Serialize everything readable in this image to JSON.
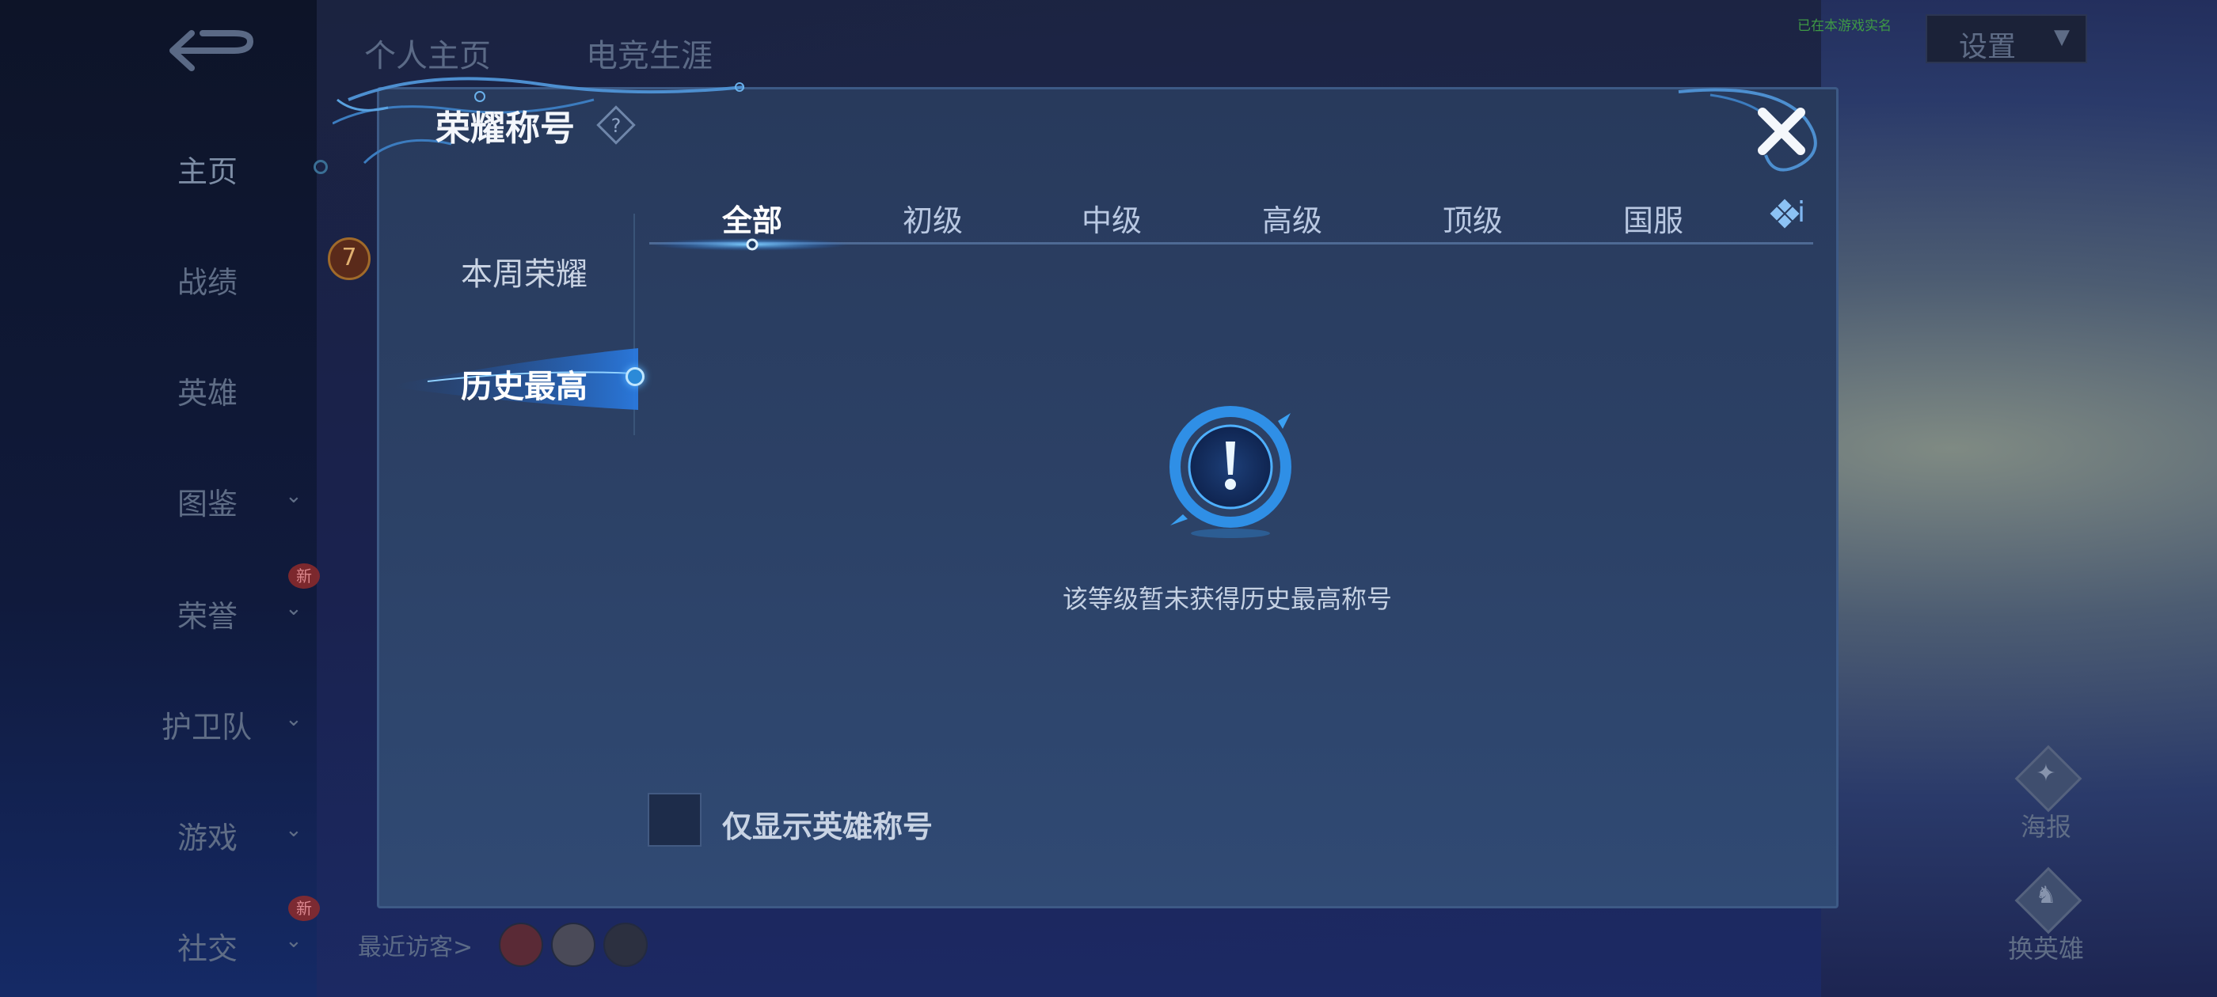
{
  "background": {
    "top_tabs": [
      "个人主页",
      "电竞生涯"
    ],
    "nav": [
      {
        "label": "主页",
        "chevron": false,
        "new_badge": false,
        "active": true
      },
      {
        "label": "战绩",
        "chevron": false,
        "new_badge": false
      },
      {
        "label": "英雄",
        "chevron": false,
        "new_badge": false
      },
      {
        "label": "图鉴",
        "chevron": true,
        "new_badge": false
      },
      {
        "label": "荣誉",
        "chevron": true,
        "new_badge": true
      },
      {
        "label": "护卫队",
        "chevron": true,
        "new_badge": false
      },
      {
        "label": "游戏",
        "chevron": true,
        "new_badge": false
      },
      {
        "label": "社交",
        "chevron": true,
        "new_badge": true
      }
    ],
    "new_badge_text": "新",
    "level_badge": "7",
    "visitors_label": "最近访客>",
    "sync_note": "已在本游戏实名",
    "settings_label": "设置",
    "side_buttons": [
      {
        "label": "海报",
        "icon": "poster-icon"
      },
      {
        "label": "换英雄",
        "icon": "switch-hero-icon"
      }
    ]
  },
  "modal": {
    "title": "荣耀称号",
    "help_icon": "question-icon",
    "close_icon": "close-icon",
    "categories": [
      {
        "label": "本周荣耀",
        "active": false
      },
      {
        "label": "历史最高",
        "active": true
      }
    ],
    "tabs": [
      {
        "label": "全部",
        "active": true
      },
      {
        "label": "初级",
        "active": false
      },
      {
        "label": "中级",
        "active": false
      },
      {
        "label": "高级",
        "active": false
      },
      {
        "label": "顶级",
        "active": false
      },
      {
        "label": "国服",
        "active": false
      }
    ],
    "tab_more_text": "i",
    "empty_message": "该等级暂未获得历史最高称号",
    "checkbox_label": "仅显示英雄称号",
    "checkbox_checked": false
  },
  "colors": {
    "accent": "#2b8ad8",
    "modal_bg": "#2c4166",
    "close": "#ffffff"
  }
}
